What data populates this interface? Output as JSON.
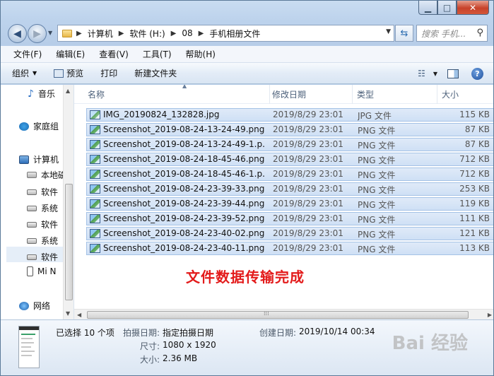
{
  "window": {
    "caption": {
      "minimize": "▁",
      "maximize": "□",
      "close": "✕"
    }
  },
  "nav": {
    "back_icon": "back-arrow-icon",
    "forward_icon": "forward-arrow-icon",
    "breadcrumbs": [
      "计算机",
      "软件 (H:)",
      "08",
      "手机相册文件"
    ],
    "search_placeholder": "搜索 手机..."
  },
  "menu": [
    "文件(F)",
    "编辑(E)",
    "查看(V)",
    "工具(T)",
    "帮助(H)"
  ],
  "toolbar": {
    "organize": "组织",
    "preview": "预览",
    "print": "打印",
    "new_folder": "新建文件夹"
  },
  "sidebar": {
    "items": [
      {
        "label": "音乐",
        "icon": "music-icon"
      },
      {
        "label": "家庭组",
        "icon": "homegroup-icon"
      },
      {
        "label": "计算机",
        "icon": "computer-icon"
      },
      {
        "label": "本地磁",
        "icon": "local-disk-icon"
      },
      {
        "label": "软件",
        "icon": "drive-icon"
      },
      {
        "label": "系统",
        "icon": "drive-icon"
      },
      {
        "label": "软件",
        "icon": "drive-icon"
      },
      {
        "label": "系统",
        "icon": "drive-icon"
      },
      {
        "label": "软件",
        "icon": "drive-icon"
      },
      {
        "label": "Mi N",
        "icon": "phone-icon"
      },
      {
        "label": "网络",
        "icon": "network-icon"
      }
    ]
  },
  "columns": {
    "name": "名称",
    "date": "修改日期",
    "type": "类型",
    "size": "大小"
  },
  "files": [
    {
      "name": "IMG_20190824_132828.jpg",
      "date": "2019/8/29 23:01",
      "type": "JPG 文件",
      "size": "115 KB",
      "kind": "jpg"
    },
    {
      "name": "Screenshot_2019-08-24-13-24-49.png",
      "date": "2019/8/29 23:01",
      "type": "PNG 文件",
      "size": "87 KB",
      "kind": "png"
    },
    {
      "name": "Screenshot_2019-08-24-13-24-49-1.p...",
      "date": "2019/8/29 23:01",
      "type": "PNG 文件",
      "size": "87 KB",
      "kind": "png"
    },
    {
      "name": "Screenshot_2019-08-24-18-45-46.png",
      "date": "2019/8/29 23:01",
      "type": "PNG 文件",
      "size": "712 KB",
      "kind": "png"
    },
    {
      "name": "Screenshot_2019-08-24-18-45-46-1.p...",
      "date": "2019/8/29 23:01",
      "type": "PNG 文件",
      "size": "712 KB",
      "kind": "png"
    },
    {
      "name": "Screenshot_2019-08-24-23-39-33.png",
      "date": "2019/8/29 23:01",
      "type": "PNG 文件",
      "size": "253 KB",
      "kind": "png"
    },
    {
      "name": "Screenshot_2019-08-24-23-39-44.png",
      "date": "2019/8/29 23:01",
      "type": "PNG 文件",
      "size": "119 KB",
      "kind": "png"
    },
    {
      "name": "Screenshot_2019-08-24-23-39-52.png",
      "date": "2019/8/29 23:01",
      "type": "PNG 文件",
      "size": "111 KB",
      "kind": "png"
    },
    {
      "name": "Screenshot_2019-08-24-23-40-02.png",
      "date": "2019/8/29 23:01",
      "type": "PNG 文件",
      "size": "121 KB",
      "kind": "png"
    },
    {
      "name": "Screenshot_2019-08-24-23-40-11.png",
      "date": "2019/8/29 23:01",
      "type": "PNG 文件",
      "size": "113 KB",
      "kind": "png"
    }
  ],
  "overlay_text": "文件数据传输完成",
  "details": {
    "selected": "已选择 10 个项",
    "shot_date_label": "拍摄日期:",
    "shot_date_value": "指定拍摄日期",
    "created_label": "创建日期:",
    "created_value": "2019/10/14 00:34",
    "dims_label": "尺寸:",
    "dims_value": "1080 x 1920",
    "size_label": "大小:",
    "size_value": "2.36 MB"
  },
  "watermark": "Bai 经验",
  "colors": {
    "accent_text": "#e31b1b",
    "selection": "#cfe0f5"
  }
}
